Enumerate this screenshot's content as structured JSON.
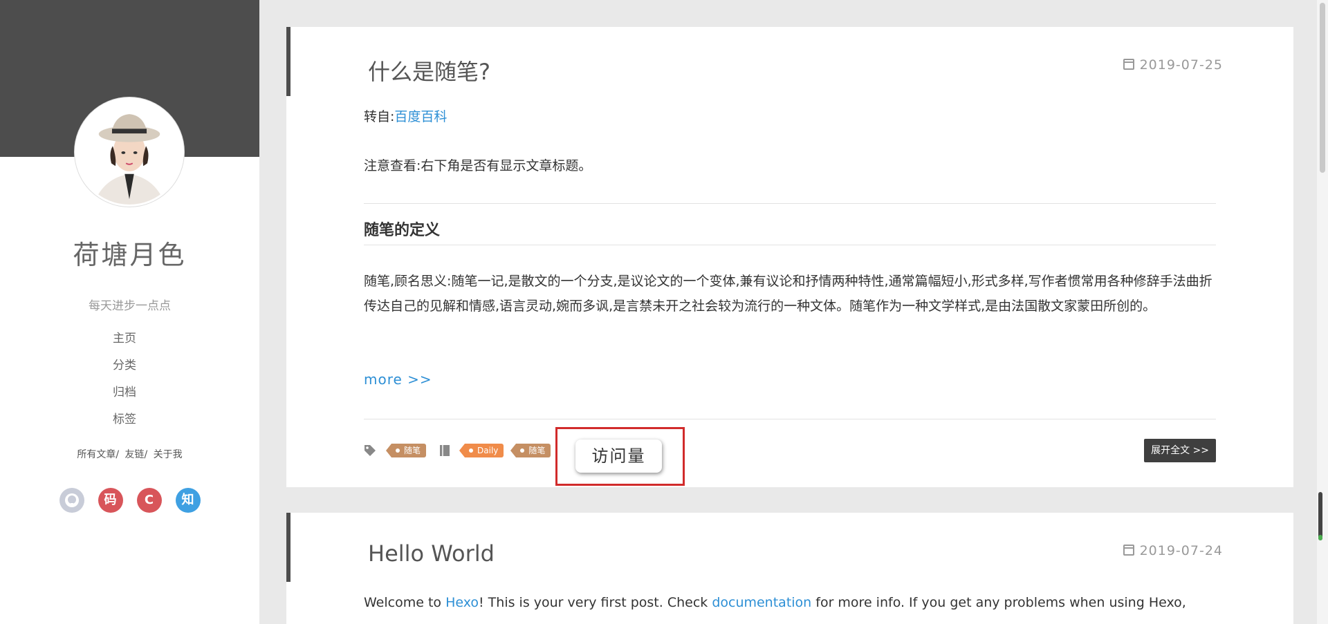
{
  "sidebar": {
    "title": "荷塘月色",
    "subtitle": "每天进步一点点",
    "nav": [
      {
        "label": "主页"
      },
      {
        "label": "分类"
      },
      {
        "label": "归档"
      },
      {
        "label": "标签"
      }
    ],
    "sublinks": [
      "所有文章/",
      "友链/",
      "关于我"
    ],
    "social": [
      {
        "name": "github-icon",
        "label": ""
      },
      {
        "name": "gitee-icon",
        "label": "码"
      },
      {
        "name": "csdn-icon",
        "label": "C"
      },
      {
        "name": "zhihu-icon",
        "label": "知"
      }
    ]
  },
  "post1": {
    "title": "什么是随笔?",
    "date": "2019-07-25",
    "source_prefix": "转自:",
    "source_link": "百度百科",
    "note": "注意查看:右下角是否有显示文章标题。",
    "heading": "随笔的定义",
    "paragraph": "随笔,顾名思义:随笔一记,是散文的一个分支,是议论文的一个变体,兼有议论和抒情两种特性,通常篇幅短小,形式多样,写作者惯常用各种修辞手法曲折传达自己的见解和情感,语言灵动,婉而多讽,是言禁未开之社会较为流行的一种文体。随笔作为一种文学样式,是由法国散文家蒙田所创的。",
    "more": "more >>",
    "tags": [
      "随笔"
    ],
    "categories": [
      "Daily",
      "随笔"
    ],
    "visit_label": "访问量",
    "expand": "展开全文 >>"
  },
  "post2": {
    "title": "Hello World",
    "date": "2019-07-24",
    "text_1": "Welcome to ",
    "link_hexo": "Hexo",
    "text_2": "! This is your very first post. Check ",
    "link_docs": "documentation",
    "text_3": " for more info. If you get any problems when using Hexo,"
  },
  "colors": {
    "accent": "#2d8fd5",
    "sidebar_dark": "#4d4d4d",
    "tag_brown": "#c58f63",
    "tag_orange": "#f08c4a",
    "highlight_red": "#d12b2b"
  }
}
